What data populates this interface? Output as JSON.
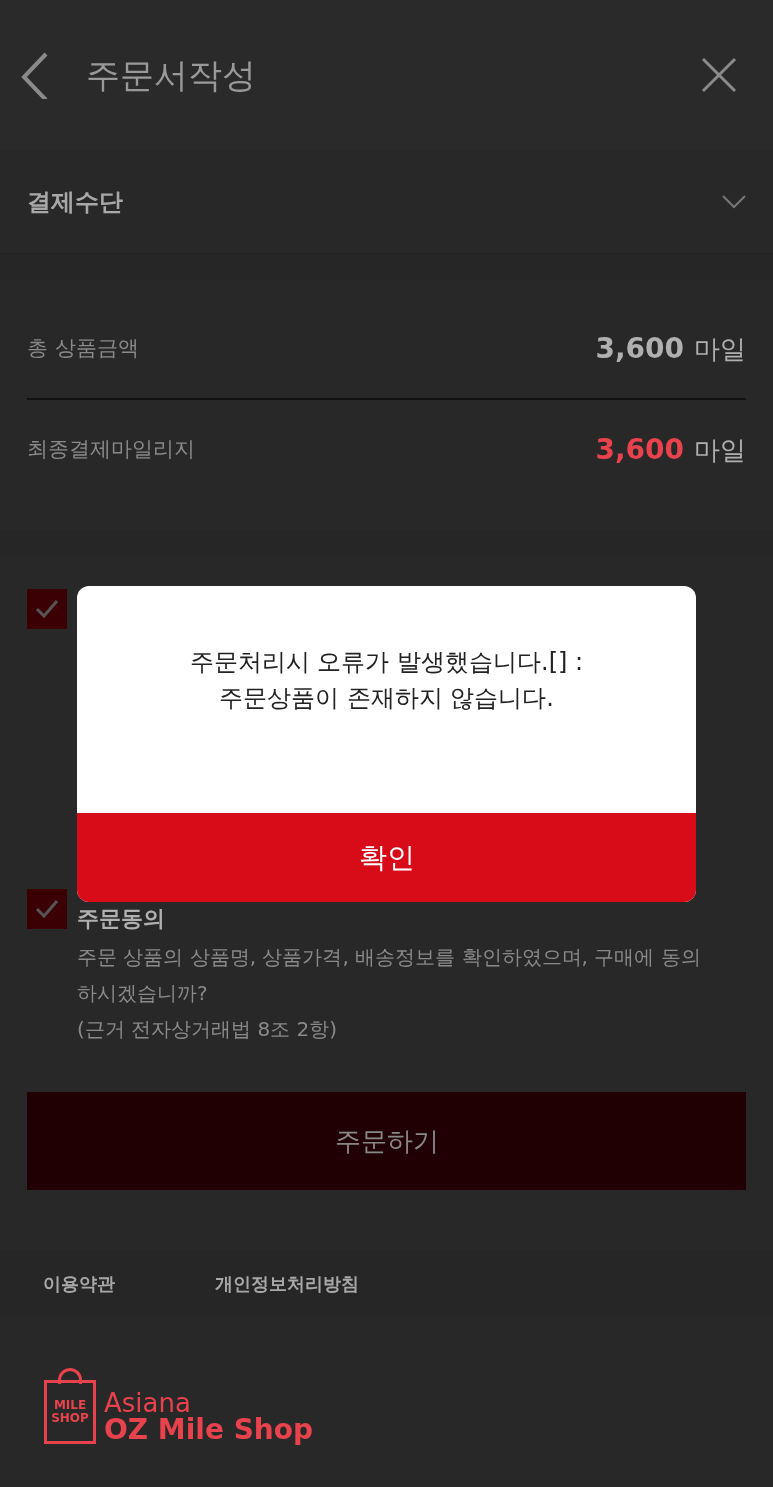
{
  "header": {
    "title": "주문서작성"
  },
  "payment_method": {
    "label": "결제수단",
    "expanded": false
  },
  "summary": [
    {
      "kind": "total",
      "label": "총 상품금액",
      "amount": "3,600",
      "unit": "마일"
    },
    {
      "kind": "final",
      "label": "최종결제마일리지",
      "amount": "3,600",
      "unit": "마일"
    }
  ],
  "agreements": [
    {
      "checked": true
    },
    {
      "checked": true,
      "title": "주문동의",
      "lines": [
        "주문 상품의 상품명, 상품가격, 배송정보를 확인하였으며, 구매에 동의하시겠습니까?",
        "(근거 전자상거래법 8조 2항)"
      ]
    }
  ],
  "order_button": "주문하기",
  "footer_links": [
    "이용약관",
    "개인정보처리방침"
  ],
  "logo": {
    "badge": [
      "MILE",
      "SHOP"
    ],
    "line1": "Asiana",
    "line2": "OZ Mile Shop"
  },
  "dialog": {
    "message": [
      "주문처리시 오류가 발생했습니다.[] :",
      "주문상품이 존재하지 않습니다."
    ],
    "confirm": "확인"
  }
}
